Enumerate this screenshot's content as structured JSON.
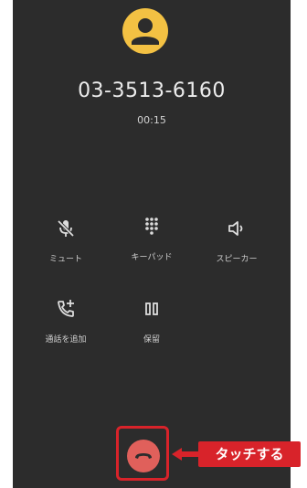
{
  "call": {
    "number": "03-3513-6160",
    "duration": "00:15"
  },
  "controls": [
    {
      "label": "ミュート",
      "icon": "mic-off-icon"
    },
    {
      "label": "キーパッド",
      "icon": "dialpad-icon"
    },
    {
      "label": "スピーカー",
      "icon": "speaker-icon"
    },
    {
      "label": "通話を追加",
      "icon": "add-call-icon"
    },
    {
      "label": "保留",
      "icon": "pause-icon"
    }
  ],
  "annotation": {
    "callout_text": "タッチする"
  },
  "colors": {
    "background": "#2c2c2c",
    "avatar": "#f3c143",
    "end_call": "#e0605b",
    "highlight": "#d8232a"
  }
}
